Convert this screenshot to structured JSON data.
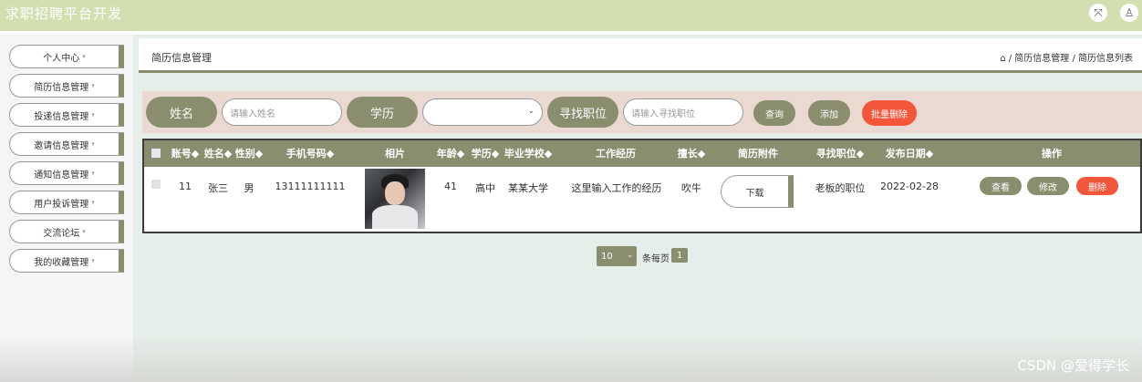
{
  "app": {
    "title": "求职招聘平台开发"
  },
  "sidebar": {
    "items": [
      {
        "label": "个人中心"
      },
      {
        "label": "简历信息管理"
      },
      {
        "label": "投递信息管理"
      },
      {
        "label": "邀请信息管理"
      },
      {
        "label": "通知信息管理"
      },
      {
        "label": "用户投诉管理"
      },
      {
        "label": "交流论坛"
      },
      {
        "label": "我的收藏管理"
      }
    ],
    "caret": "▾"
  },
  "header": {
    "page_title": "简历信息管理",
    "breadcrumb": "⌂ / 简历信息管理 / 简历信息列表"
  },
  "search": {
    "name_label": "姓名",
    "name_placeholder": "请输入姓名",
    "education_label": "学历",
    "education_value": "",
    "job_label": "寻找职位",
    "job_placeholder": "请输入寻找职位",
    "query_btn": "查询",
    "add_btn": "添加",
    "batch_delete_btn": "批量删除"
  },
  "table": {
    "columns": [
      "账号◆",
      "姓名◆",
      "性别◆",
      "手机号码◆",
      "相片",
      "年龄◆",
      "学历◆",
      "毕业学校◆",
      "工作经历",
      "擅长◆",
      "简历附件",
      "寻找职位◆",
      "发布日期◆",
      "操作"
    ],
    "rows": [
      {
        "account": "11",
        "name": "张三",
        "gender": "男",
        "phone": "13111111111",
        "age": "41",
        "education": "高中",
        "school": "某某大学",
        "experience": "这里输入工作的经历",
        "skill": "吹牛",
        "attachment_btn": "下载",
        "job": "老板的职位",
        "date": "2022-02-28",
        "view_btn": "查看",
        "edit_btn": "修改",
        "delete_btn": "删除"
      }
    ]
  },
  "pagination": {
    "page_size": "10",
    "per_page_label": "条每页",
    "current_page": "1"
  },
  "watermark": "CSDN @爱得学长",
  "colors": {
    "topbar": "#d3dfb0",
    "accent": "#8b8e6e",
    "danger": "#f4563c",
    "search_bg": "#e9d9d1",
    "main_bg": "#e6eee9"
  }
}
